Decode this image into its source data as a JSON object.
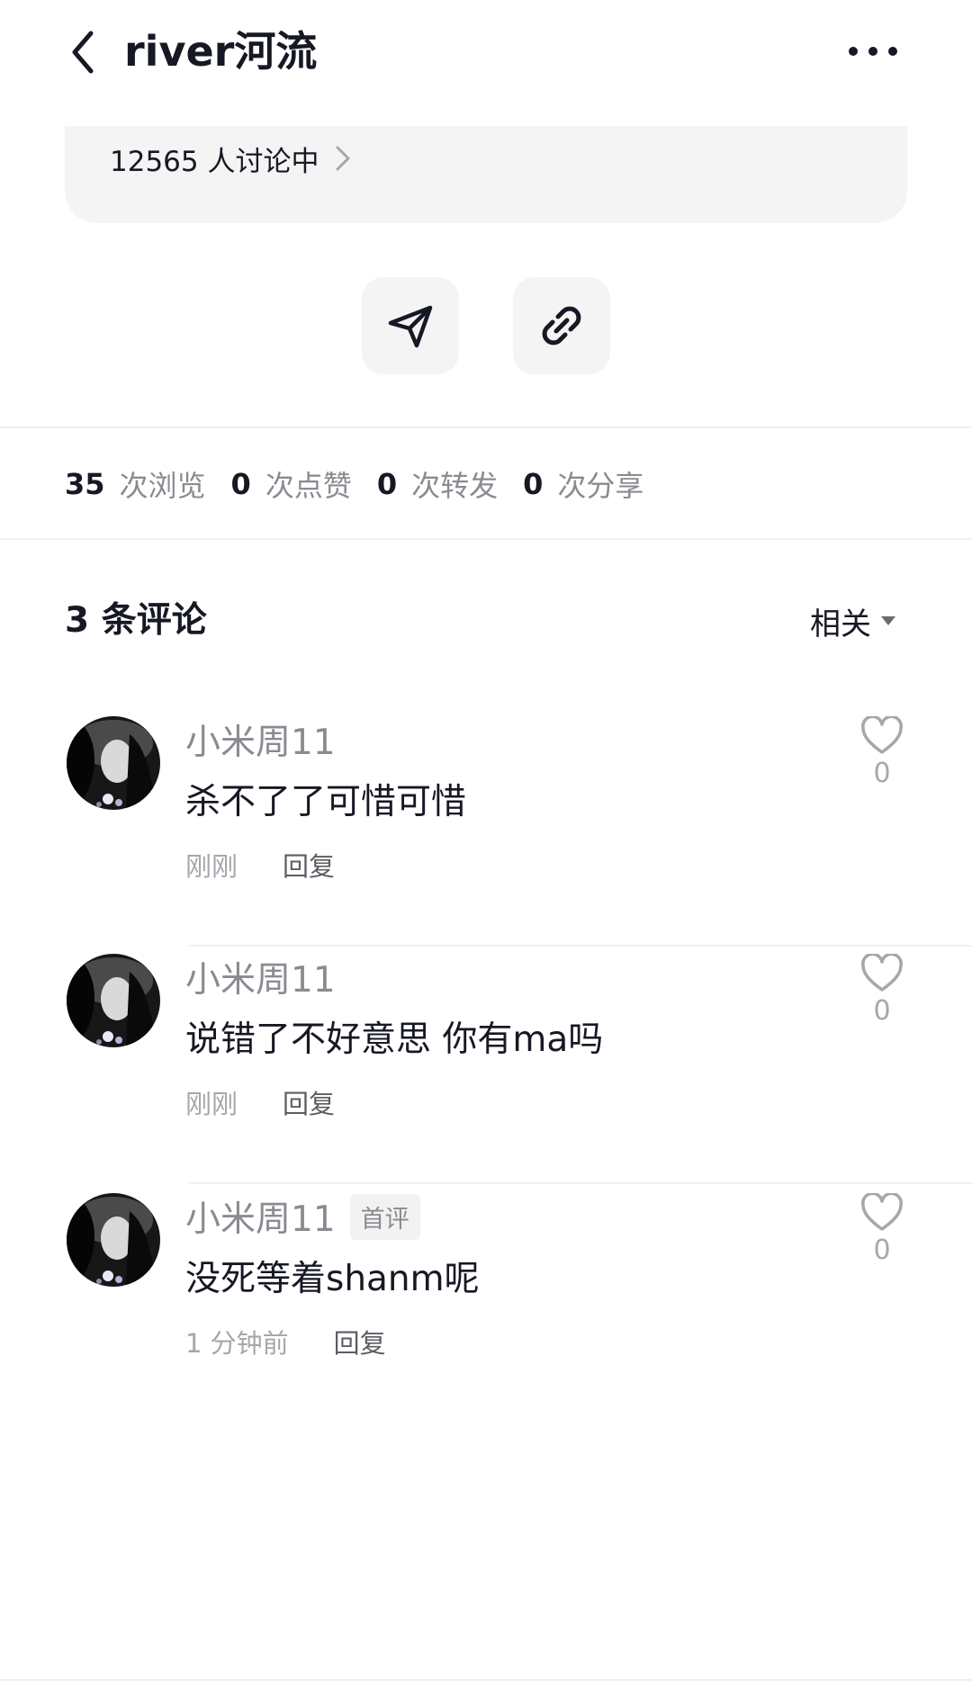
{
  "header": {
    "title": "river河流"
  },
  "discussion": {
    "text": "12565 人讨论中"
  },
  "stats": [
    {
      "num": "35",
      "label": "次浏览"
    },
    {
      "num": "0",
      "label": "次点赞"
    },
    {
      "num": "0",
      "label": "次转发"
    },
    {
      "num": "0",
      "label": "次分享"
    }
  ],
  "comments_header": {
    "count_label": "3 条评论",
    "sort_label": "相关"
  },
  "comments": [
    {
      "username": "小米周11",
      "tag": "",
      "text": "杀不了了可惜可惜",
      "time": "刚刚",
      "reply_label": "回复",
      "likes": "0"
    },
    {
      "username": "小米周11",
      "tag": "",
      "text": "说错了不好意思 你有ma吗",
      "time": "刚刚",
      "reply_label": "回复",
      "likes": "0"
    },
    {
      "username": "小米周11",
      "tag": "首评",
      "text": "没死等着shanm呢",
      "time": "1 分钟前",
      "reply_label": "回复",
      "likes": "0"
    }
  ],
  "icons": {
    "back": "chevron-left-icon",
    "more": "more-dots-icon",
    "send": "paper-plane-icon",
    "link": "link-icon",
    "like": "heart-outline-icon"
  }
}
